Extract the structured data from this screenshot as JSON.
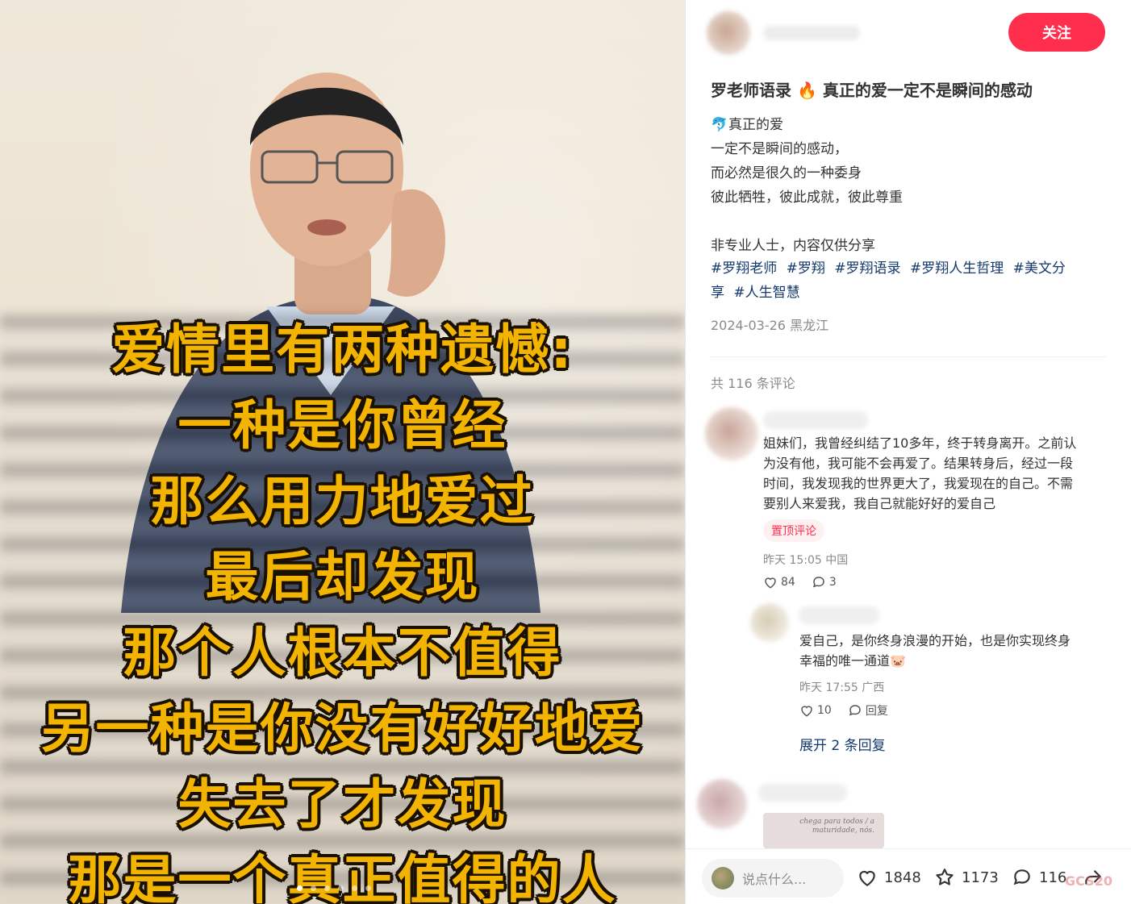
{
  "media": {
    "caption_lines": [
      "爱情里有两种遗憾:",
      "一种是你曾经",
      "那么用力地爱过",
      "最后却发现",
      "那个人根本不值得",
      "另一种是你没有好好地爱",
      "失去了才发现",
      "那是一个真正值得的人"
    ],
    "carousel_dots": 6,
    "active_dot": 1
  },
  "author": {
    "follow_label": "关注"
  },
  "post": {
    "title_prefix": "罗老师语录",
    "title_icon": "🔥",
    "title_suffix": "真正的爱一定不是瞬间的感动",
    "desc_icon": "🐬",
    "desc_lines": [
      "真正的爱",
      "一定不是瞬间的感动，",
      "而必然是很久的一种委身",
      "彼此牺牲，彼此成就，彼此尊重",
      "",
      "非专业人士，内容仅供分享"
    ],
    "tags": [
      "#罗翔老师",
      "#罗翔",
      "#罗翔语录",
      "#罗翔人生哲理",
      "#美文分",
      "享",
      "#人生智慧"
    ],
    "date": "2024-03-26 黑龙江"
  },
  "comments": {
    "count_label": "共 116 条评论",
    "top": {
      "text_lines": [
        "姐妹们，我曾经纠结了10多年，终于转身离开。之前认",
        "为没有他，我可能不会再爱了。结果转身后，经过一段",
        "时间，我发现我的世界更大了，我爱现在的自己。不需",
        "要别人来爱我，我自己就能好好的爱自己"
      ],
      "pin_label": "置顶评论",
      "meta": "昨天 15:05 中国",
      "likes": "84",
      "replies": "3"
    },
    "reply": {
      "text_lines": [
        "爱自己，是你终身浪漫的开始，也是你实现终身",
        "幸福的唯一通道"
      ],
      "emoji": "🐷",
      "meta": "昨天 17:55 广西",
      "likes": "10",
      "reply_label": "回复"
    },
    "expand_label": "展开 2 条回复",
    "preview_image_text": "chega para todos / a maturidade, nós."
  },
  "bottom_bar": {
    "input_placeholder": "说点什么...",
    "likes": "1848",
    "collects": "1173",
    "comments": "116",
    "watermark": "GCS20"
  },
  "colors": {
    "accent": "#ff2e4d",
    "tag": "#13386c",
    "caption": "#f2b400"
  }
}
